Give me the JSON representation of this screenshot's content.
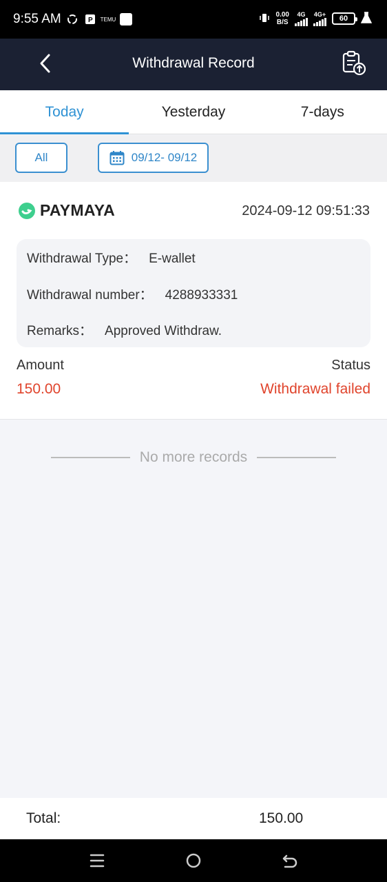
{
  "status_bar": {
    "time": "9:55 AM",
    "net_speed_value": "0.00",
    "net_speed_unit": "B/S",
    "sim1_label": "4G",
    "sim2_label": "4G+",
    "battery": "60",
    "temu_label": "TEMU"
  },
  "app_bar": {
    "title": "Withdrawal Record"
  },
  "tabs": [
    {
      "label": "Today",
      "active": true
    },
    {
      "label": "Yesterday",
      "active": false
    },
    {
      "label": "7-days",
      "active": false
    }
  ],
  "filters": {
    "all_label": "All",
    "date_range": "09/12- 09/12"
  },
  "record": {
    "channel": "PAYMAYA",
    "datetime": "2024-09-12 09:51:33",
    "withdrawal_type_label": "Withdrawal Type：",
    "withdrawal_type_value": "E-wallet",
    "withdrawal_number_label": "Withdrawal number：",
    "withdrawal_number_value": "4288933331",
    "remarks_label": "Remarks：",
    "remarks_value": "Approved Withdraw.",
    "amount_label": "Amount",
    "amount_value": "150.00",
    "status_label": "Status",
    "status_value": "Withdrawal failed"
  },
  "list_footer": "No more records",
  "summary": {
    "total_label": "Total:",
    "total_value": "150.00"
  },
  "colors": {
    "accent": "#2f92d4",
    "header_bg": "#1b2133",
    "error": "#e0442c",
    "paymaya_green": "#3ecf8e"
  }
}
